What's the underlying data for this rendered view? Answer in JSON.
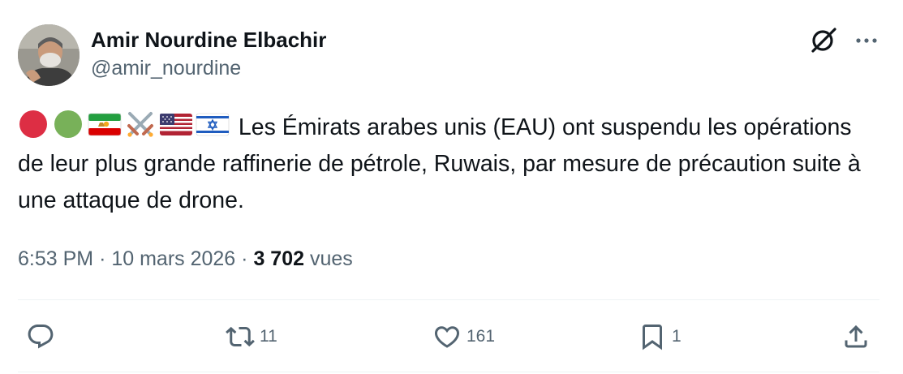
{
  "author": {
    "display_name": "Amir Nourdine Elbachir",
    "handle": "@amir_nourdine"
  },
  "header_icons": {
    "grok": "grok-icon",
    "more": "more-icon"
  },
  "tweet": {
    "emojis": [
      "red-circle",
      "green-circle",
      "iran-lion-sun-flag",
      "crossed-swords",
      "us-flag",
      "israel-flag"
    ],
    "text": "Les Émirats arabes unis (EAU) ont suspendu les opérations de leur plus grande raffinerie de pétrole, Ruwais, par mesure de précaution suite à une attaque de drone."
  },
  "meta": {
    "time": "6:53 PM",
    "separator": "·",
    "date": "10 mars 2026",
    "views_count": "3 702",
    "views_label": "vues"
  },
  "actions": {
    "reply_count": "",
    "retweet_count": "11",
    "like_count": "161",
    "bookmark_count": "1"
  },
  "colors": {
    "text": "#0f1419",
    "secondary": "#536471",
    "divider": "#eff3f4",
    "red_circle": "#dd2e44",
    "green_circle": "#78b159"
  }
}
